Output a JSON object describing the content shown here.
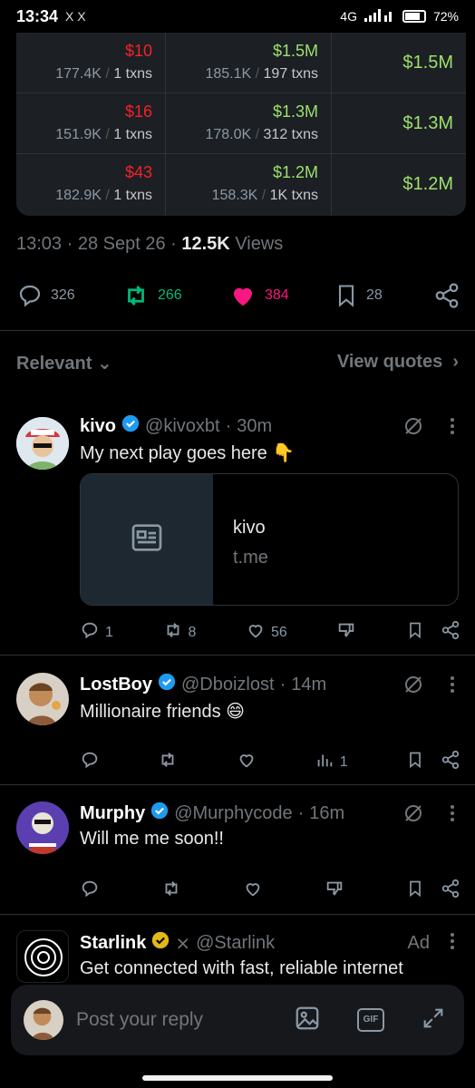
{
  "status_bar": {
    "time": "13:34",
    "apps": "X  X",
    "network": "4G",
    "battery": "72%"
  },
  "table": {
    "rows": [
      {
        "left_value": "$10",
        "left_sub_a": "177.4K",
        "left_sub_b": "1 txns",
        "mid_value": "$1.5M",
        "mid_sub_a": "185.1K",
        "mid_sub_b": "197 txns",
        "right_value": "$1.5M"
      },
      {
        "left_value": "$16",
        "left_sub_a": "151.9K",
        "left_sub_b": "1 txns",
        "mid_value": "$1.3M",
        "mid_sub_a": "178.0K",
        "mid_sub_b": "312 txns",
        "right_value": "$1.3M"
      },
      {
        "left_value": "$43",
        "left_sub_a": "182.9K",
        "left_sub_b": "1 txns",
        "mid_value": "$1.2M",
        "mid_sub_a": "158.3K",
        "mid_sub_b": "1K txns",
        "right_value": "$1.2M"
      }
    ]
  },
  "meta": {
    "time": "13:03",
    "date": "28 Sept 26",
    "views_count": "12.5K",
    "views_label": "Views"
  },
  "actions": {
    "replies": "326",
    "reposts": "266",
    "likes": "384",
    "bookmarks": "28",
    "colors": {
      "repost": "#00ba7c",
      "like": "#f91880"
    }
  },
  "sort": {
    "label": "Relevant",
    "view_quotes": "View quotes"
  },
  "replies": [
    {
      "name": "kivo",
      "handle": "@kivoxbt",
      "time": "30m",
      "text": "My next play goes here 👇",
      "card_title": "kivo",
      "card_domain": "t.me",
      "reply_count": "1",
      "repost_count": "8",
      "like_count": "56"
    },
    {
      "name": "LostBoy",
      "handle": "@Dboizlost",
      "time": "14m",
      "text": "Millionaire friends 😄",
      "views_count": "1"
    },
    {
      "name": "Murphy",
      "handle": "@Murphycode",
      "time": "16m",
      "text": "Will me me soon!!"
    },
    {
      "name": "Starlink",
      "handle": "@Starlink",
      "ad_label": "Ad",
      "text": "Get connected with fast, reliable internet"
    }
  ],
  "composer": {
    "placeholder": "Post your reply",
    "gif_label": "GIF"
  }
}
